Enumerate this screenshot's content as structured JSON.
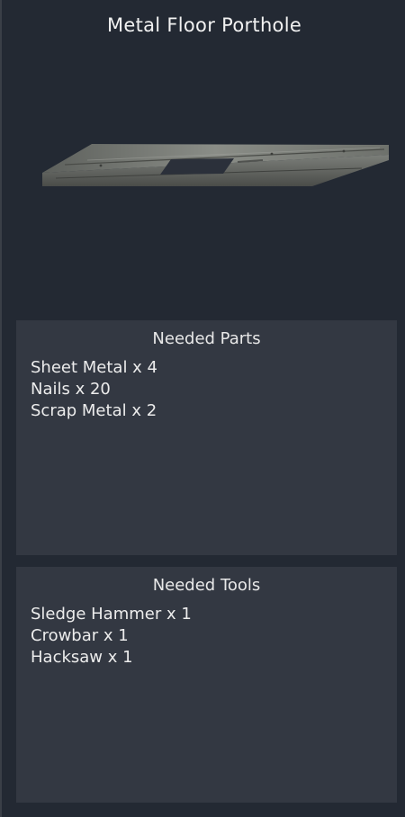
{
  "title": "Metal Floor Porthole",
  "preview": {
    "icon": "metal-floor-porthole-model"
  },
  "needed_parts": {
    "heading": "Needed Parts",
    "items": [
      "Sheet Metal x 4",
      "Nails x 20",
      "Scrap Metal x 2"
    ]
  },
  "needed_tools": {
    "heading": "Needed Tools",
    "items": [
      "Sledge Hammer x 1",
      "Crowbar x 1",
      "Hacksaw x 1"
    ]
  },
  "colors": {
    "background": "#232933",
    "section_background": "#333842",
    "text": "#ececec"
  }
}
